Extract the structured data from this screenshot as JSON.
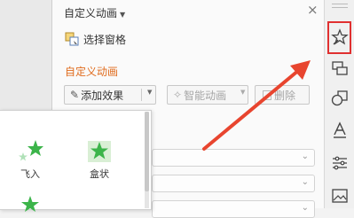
{
  "pane": {
    "title": "自定义动画",
    "select_pane_label": "选择窗格",
    "section_title": "自定义动画",
    "add_effect_label": "添加效果",
    "smart_animation_label": "智能动画",
    "delete_label": "删除"
  },
  "effects": [
    {
      "label": "飞入",
      "icon": "star-fly-in-icon"
    },
    {
      "label": "盒状",
      "icon": "star-box-icon"
    },
    {
      "label": "",
      "icon": "star-partial-icon"
    }
  ],
  "right_toolbar": [
    "custom-animation-icon",
    "slide-switch-icon",
    "shapes-icon",
    "text-style-icon",
    "properties-icon",
    "picture-icon"
  ],
  "colors": {
    "accent_orange": "#e06c1e",
    "star_green": "#3cb44a",
    "highlight_red": "#e03030"
  }
}
